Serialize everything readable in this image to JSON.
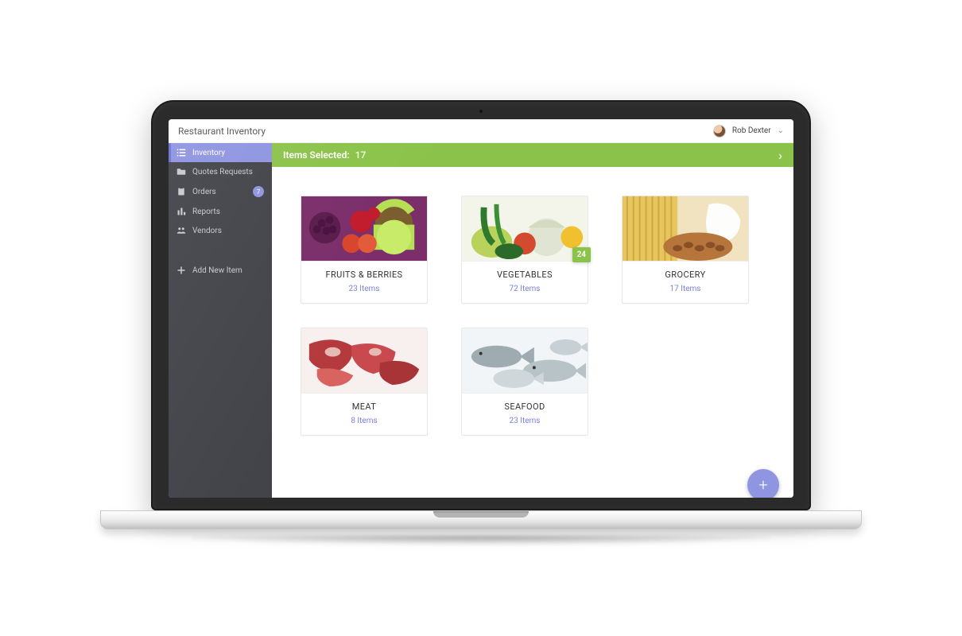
{
  "header": {
    "title": "Restaurant Inventory",
    "user_name": "Rob Dexter"
  },
  "sidebar": {
    "items": [
      {
        "label": "Inventory",
        "icon": "list-icon",
        "active": true
      },
      {
        "label": "Quotes Requests",
        "icon": "folder-icon"
      },
      {
        "label": "Orders",
        "icon": "clipboard-icon",
        "badge": "7"
      },
      {
        "label": "Reports",
        "icon": "bar-chart-icon"
      },
      {
        "label": "Vendors",
        "icon": "group-icon"
      }
    ],
    "add_item_label": "Add New Item"
  },
  "greenbar": {
    "label": "Items Selected:",
    "count": "17"
  },
  "categories": [
    {
      "name": "FRUITS & BERRIES",
      "items_label": "23 Items"
    },
    {
      "name": "VEGETABLES",
      "items_label": "72 Items",
      "selected_badge": "24"
    },
    {
      "name": "GROCERY",
      "items_label": "17 Items"
    },
    {
      "name": "MEAT",
      "items_label": "8 Items"
    },
    {
      "name": "SEAFOOD",
      "items_label": "23 Items"
    }
  ],
  "fab_label": "+"
}
